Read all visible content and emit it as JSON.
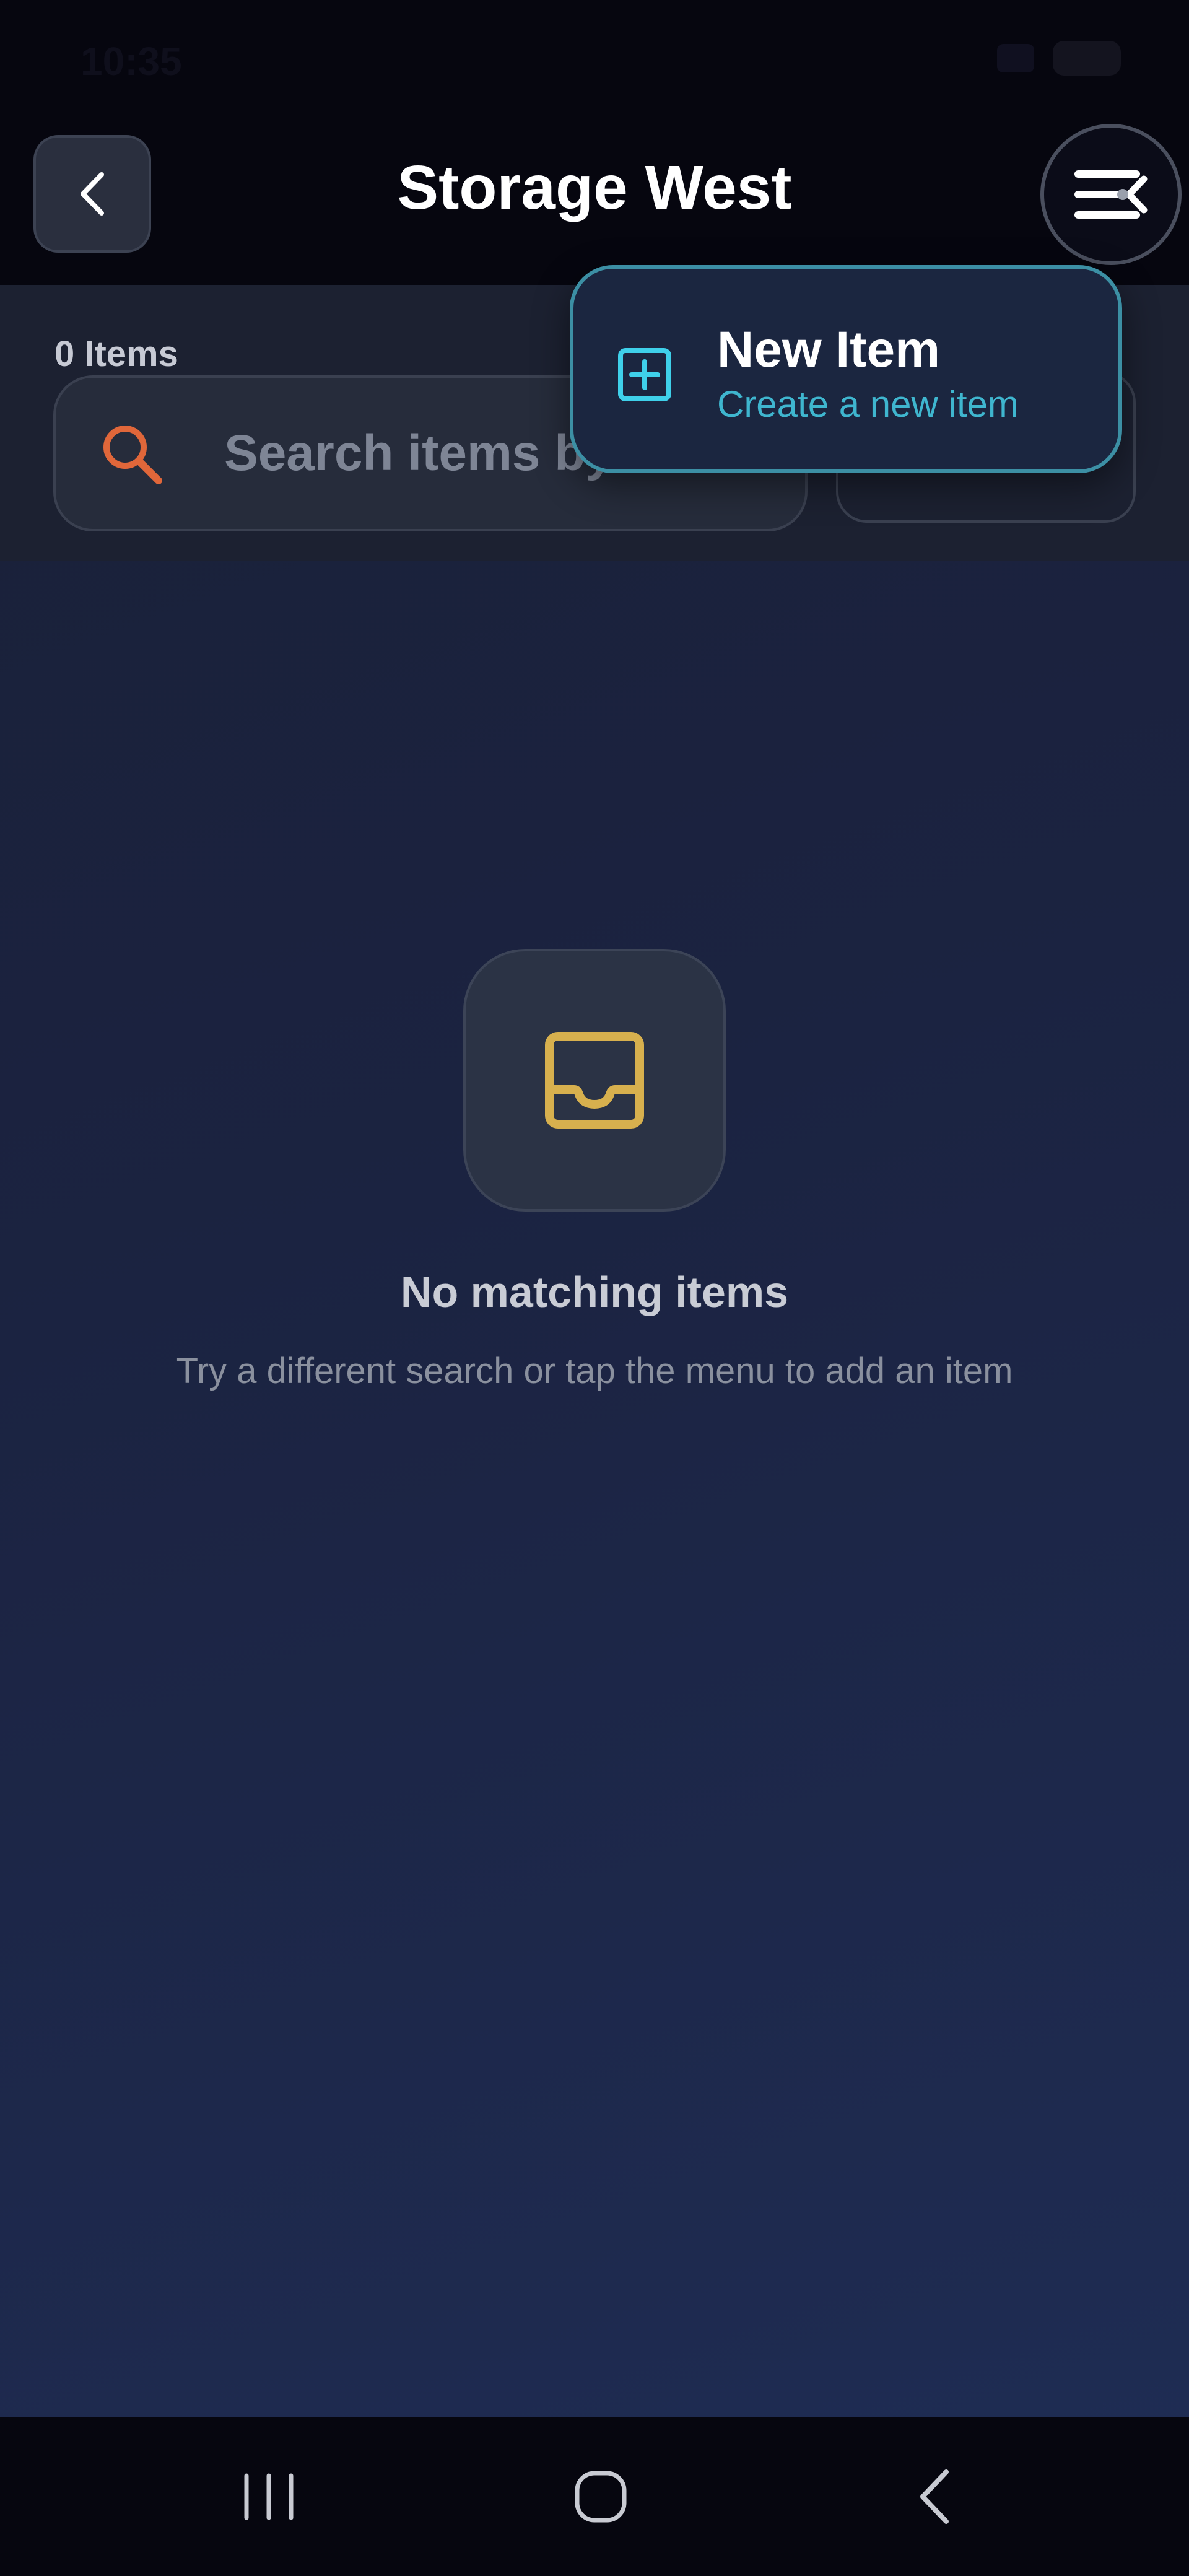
{
  "status_bar": {
    "time": "10:35"
  },
  "header": {
    "title": "Storage West",
    "back_icon": "chevron-left-icon",
    "menu_icon": "menu-close-icon"
  },
  "toolbar": {
    "items_count": "0 Items",
    "search": {
      "placeholder": "Search items by",
      "value": ""
    }
  },
  "dropdown": {
    "items": [
      {
        "title": "New Item",
        "subtitle": "Create a new item",
        "icon": "plus-square-icon"
      }
    ]
  },
  "empty_state": {
    "icon": "inbox-icon",
    "title": "No matching items",
    "subtitle": "Try a different search or tap the menu to add an item"
  },
  "nav_bar": {
    "items": [
      "recents-icon",
      "home-icon",
      "back-icon"
    ]
  },
  "colors": {
    "accent_cyan": "#3fb6cf",
    "search_icon": "#e0673a",
    "inbox_icon": "#d7b04e",
    "background": "#1b2341"
  }
}
